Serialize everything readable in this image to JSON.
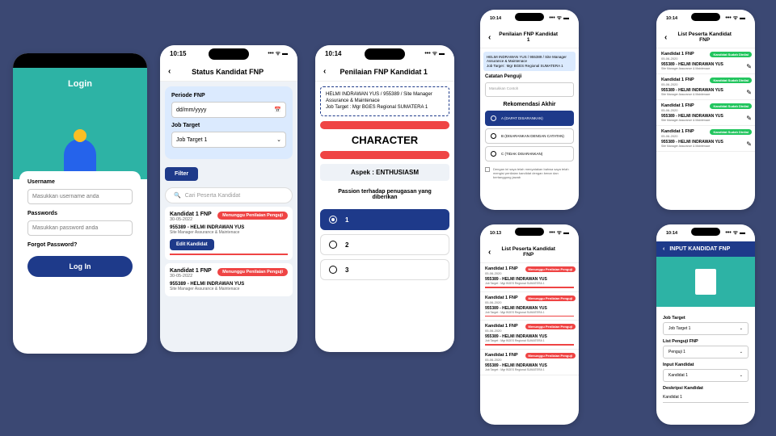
{
  "time1": "10:15",
  "time2": "10:14",
  "time3": "10:14",
  "time4": "10:13",
  "time5": "10:14",
  "time6": "10:14",
  "signals": "••• ᯤ ▬",
  "login": {
    "title": "Login",
    "user_lbl": "Username",
    "user_ph": "Masukkan username anda",
    "pass_lbl": "Passwords",
    "pass_ph": "Masukkan password anda",
    "forgot": "Forgot Password?",
    "btn": "Log In"
  },
  "status": {
    "title": "Status Kandidat FNP",
    "periode_lbl": "Periode FNP",
    "periode_ph": "dd/mm/yyyy",
    "job_lbl": "Job Target",
    "job_val": "Job Target 1",
    "filter": "Filter",
    "search_ph": "Cari Peserta Kandidat",
    "edit": "Edit Kandidat",
    "pending": "Menunggu Penilaian Penguji",
    "items": [
      {
        "t": "Kandidat 1 FNP",
        "d": "30-05-2022",
        "s": "955389 - HELMI INDRAWAN YUS",
        "r": "Site Manager Assurance & Maintenace"
      },
      {
        "t": "Kandidat 1 FNP",
        "d": "30-05-2022",
        "s": "955389 - HELMI INDRAWAN YUS",
        "r": "Site Manager Assurance & Maintenace"
      }
    ]
  },
  "penilaian": {
    "title": "Penilaian FNP Kandidat 1",
    "info1": "HELMI INDRAWAN YUS / 955389 / Site Manager Assurance & Maintenace",
    "info2": "Job Target : Mgr BGES Regional SUMATERA 1",
    "char": "CHARACTER",
    "aspek": "Aspek : ENTHUSIASM",
    "quest": "Passion terhadap penugasan yang diberikan",
    "opts": [
      "1",
      "2",
      "3"
    ]
  },
  "rekom": {
    "title": "Penilaian FNP Kandidat 1",
    "info1": "HELMI INDRAWAN YUS / 955389 / Site Manager Assurance & Maintenace",
    "info2": "Job Target : Mgr BGES Regional SUMATERA 1",
    "catatan_lbl": "Catatan Penguji",
    "catatan_ph": "Masukkan Contoh",
    "hdr": "Rekomendasi Akhir",
    "opts": [
      "A (DAPAT DISARANKAN)",
      "B (DISARANKAN DENGAN CATATAN)",
      "C (TIDAK DISARANKAN)"
    ],
    "agree": "Dengan ini saya telah menyatakan bahwa saya telah mengisi penilaian kandidat dengan benar dan bertanggung jawab"
  },
  "list_pending": {
    "title": "List Peserta Kandidat FNP",
    "pill": "Menunggu Penilaian Penguji",
    "items": [
      {
        "t": "Kandidat 1 FNP",
        "d": "05-06-2020",
        "s": "955389 - HELMI INDRAWAN YUS",
        "r": "Job Target : Mgr BGES Regional SUMATERA 1"
      },
      {
        "t": "Kandidat 1 FNP",
        "d": "05-06-2020",
        "s": "955389 - HELMI INDRAWAN YUS",
        "r": "Job Target : Mgr BGES Regional SUMATERA 1"
      },
      {
        "t": "Kandidat 1 FNP",
        "d": "05-06-2020",
        "s": "955389 - HELMI INDRAWAN YUS",
        "r": "Job Target : Mgr BGES Regional SUMATERA 1"
      },
      {
        "t": "Kandidat 1 FNP",
        "d": "05-06-2020",
        "s": "955389 - HELMI INDRAWAN YUS",
        "r": "Job Target : Mgr BGES Regional SUMATERA 1"
      }
    ]
  },
  "list_done": {
    "title": "List Peserta Kandidat FNP",
    "pill": "Kandidat Sudah Dinilai",
    "items": [
      {
        "t": "Kandidat 1 FNP",
        "d": "05-06-2020",
        "s": "955389 - HELMI INDRAWAN YUS",
        "r": "Site Manager Assurance & Maintenace"
      },
      {
        "t": "Kandidat 1 FNP",
        "d": "05-06-2020",
        "s": "955389 - HELMI INDRAWAN YUS",
        "r": "Site Manager Assurance & Maintenace"
      },
      {
        "t": "Kandidat 1 FNP",
        "d": "05-06-2020",
        "s": "955389 - HELMI INDRAWAN YUS",
        "r": "Site Manager Assurance & Maintenace"
      },
      {
        "t": "Kandidat 1 FNP",
        "d": "05-06-2020",
        "s": "955389 - HELMI INDRAWAN YUS",
        "r": "Site Manager Assurance & Maintenace"
      }
    ]
  },
  "input": {
    "title": "INPUT KANDIDAT FNP",
    "job_lbl": "Job Target",
    "job_val": "Job Target 1",
    "list_lbl": "List Penguji FNP",
    "list_val": "Penguji 1",
    "kand_lbl": "Input Kandidat",
    "kand_val": "Kandidat 1",
    "desk_lbl": "Deskripsi Kandidat",
    "desk_val": "Kandidat 1"
  }
}
